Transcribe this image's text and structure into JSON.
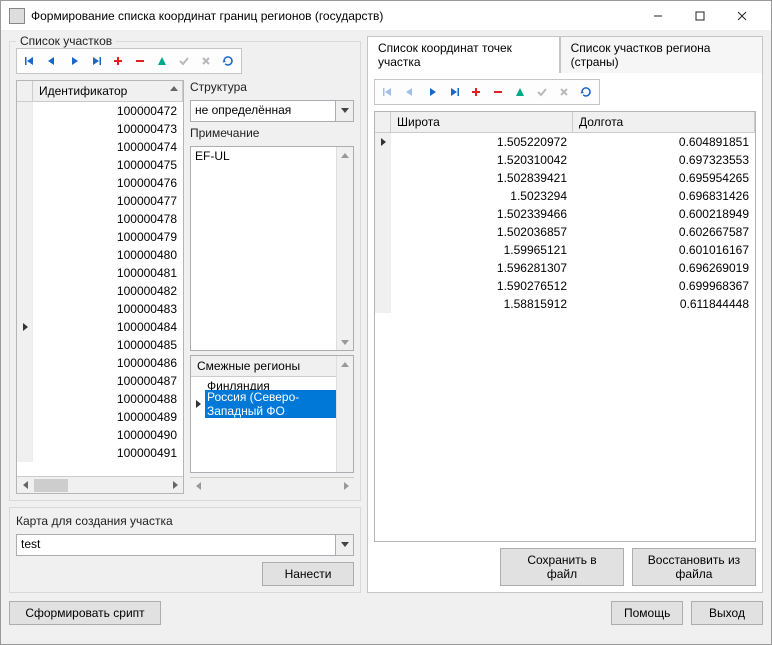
{
  "window": {
    "title": "Формирование списка координат границ регионов (государств)"
  },
  "leftGroup": {
    "title": "Список участков"
  },
  "idGrid": {
    "header": "Идентификатор",
    "rows": [
      "100000472",
      "100000473",
      "100000474",
      "100000475",
      "100000476",
      "100000477",
      "100000478",
      "100000479",
      "100000480",
      "100000481",
      "100000482",
      "100000483",
      "100000484",
      "100000485",
      "100000486",
      "100000487",
      "100000488",
      "100000489",
      "100000490",
      "100000491"
    ],
    "currentIndex": 12
  },
  "structure": {
    "label": "Структура",
    "value": "не определённая"
  },
  "note": {
    "label": "Примечание",
    "value": "EF-UL"
  },
  "adjacent": {
    "header": "Смежные регионы",
    "items": [
      "Финляндия",
      "Россия (Северо-Западный ФО"
    ],
    "selectedIndex": 1
  },
  "mapGroup": {
    "title": "Карта для создания участка",
    "value": "test",
    "applyBtn": "Нанести"
  },
  "tabs": {
    "t1": "Список координат точек участка",
    "t2": "Список участков региона (страны)"
  },
  "coordGrid": {
    "col1": "Широта",
    "col2": "Долгота",
    "rows": [
      {
        "lat": "1.505220972",
        "lon": "0.604891851"
      },
      {
        "lat": "1.520310042",
        "lon": "0.697323553"
      },
      {
        "lat": "1.502839421",
        "lon": "0.695954265"
      },
      {
        "lat": "1.5023294",
        "lon": "0.696831426"
      },
      {
        "lat": "1.502339466",
        "lon": "0.600218949"
      },
      {
        "lat": "1.502036857",
        "lon": "0.602667587"
      },
      {
        "lat": "1.59965121",
        "lon": "0.601016167"
      },
      {
        "lat": "1.596281307",
        "lon": "0.696269019"
      },
      {
        "lat": "1.590276512",
        "lon": "0.699968367"
      },
      {
        "lat": "1.58815912",
        "lon": "0.611844448"
      }
    ]
  },
  "buttons": {
    "saveFile": "Сохранить в файл",
    "restoreFile": "Восстановить из файла",
    "formScript": "Сформировать срипт",
    "help": "Помощь",
    "exit": "Выход"
  }
}
